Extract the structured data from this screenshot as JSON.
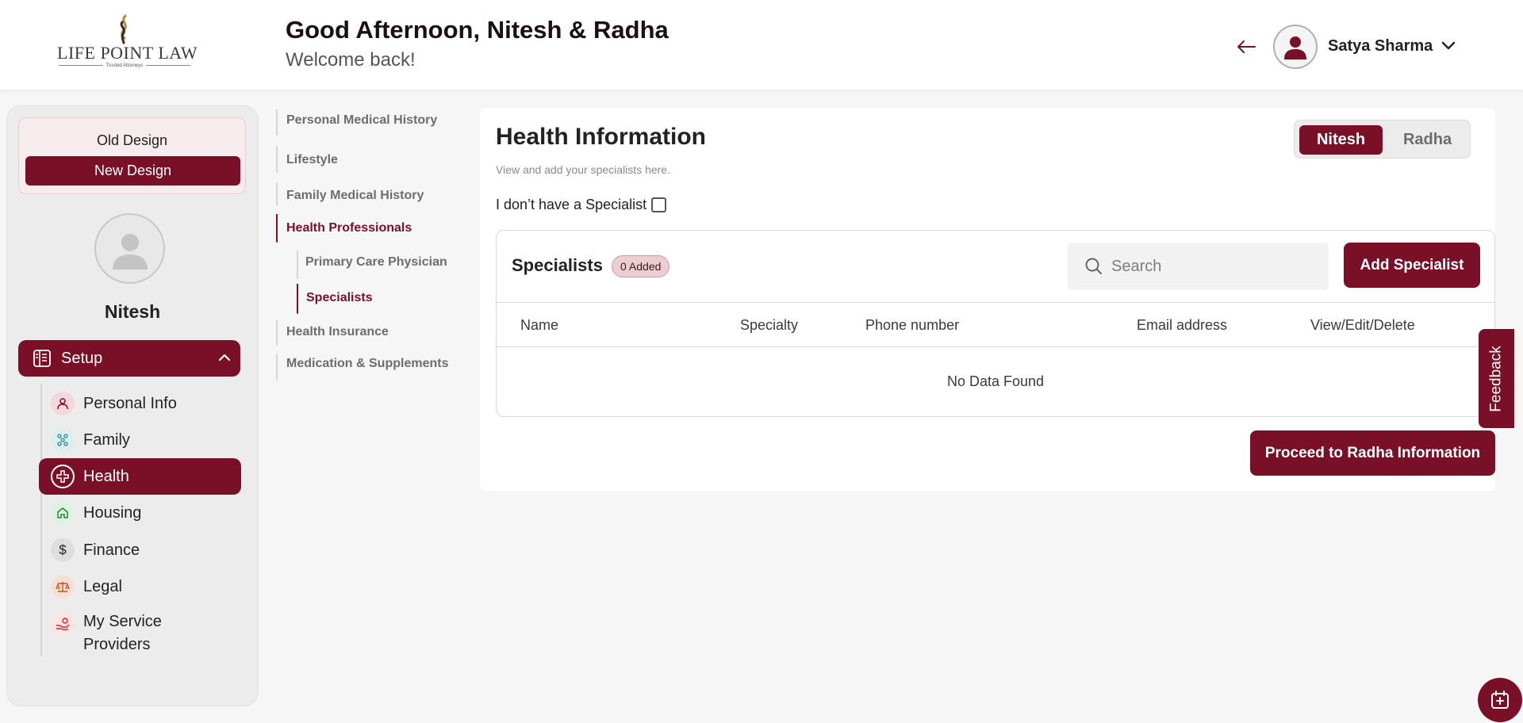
{
  "header": {
    "logo_text": "LIFE POINT LAW",
    "logo_tagline": "Trusted Attorneys",
    "greeting": "Good Afternoon, Nitesh & Radha",
    "welcome": "Welcome back!",
    "user_name": "Satya Sharma"
  },
  "sidebar": {
    "old_design": "Old Design",
    "new_design": "New Design",
    "profile_name": "Nitesh",
    "setup_label": "Setup",
    "items": [
      {
        "label": "Personal Info",
        "icon": "person-icon"
      },
      {
        "label": "Family",
        "icon": "family-icon"
      },
      {
        "label": "Health",
        "icon": "health-icon",
        "active": true
      },
      {
        "label": "Housing",
        "icon": "home-icon"
      },
      {
        "label": "Finance",
        "icon": "dollar-icon"
      },
      {
        "label": "Legal",
        "icon": "scales-icon"
      },
      {
        "label": "My Service Providers",
        "icon": "service-hand-icon"
      }
    ]
  },
  "section_nav": {
    "items": [
      {
        "label": "Personal Medical History"
      },
      {
        "label": "Lifestyle"
      },
      {
        "label": "Family Medical History"
      },
      {
        "label": "Health Professionals",
        "active": true
      },
      {
        "label": "Primary Care Physician",
        "sub": true
      },
      {
        "label": "Specialists",
        "sub": true,
        "active": true
      },
      {
        "label": "Health Insurance"
      },
      {
        "label": "Medication & Supplements"
      }
    ]
  },
  "main": {
    "title": "Health Information",
    "subtitle": "View and add your specialists here.",
    "toggle": {
      "primary": "Nitesh",
      "secondary": "Radha"
    },
    "no_specialist_label": "I don’t have a Specialist",
    "specialists_title": "Specialists",
    "added_badge": "0 Added",
    "search_placeholder": "Search",
    "add_button": "Add Specialist",
    "columns": [
      "Name",
      "Specialty",
      "Phone number",
      "Email address",
      "View/Edit/Delete"
    ],
    "empty_text": "No Data Found",
    "proceed_button": "Proceed to Radha Information"
  },
  "feedback_label": "Feedback",
  "colors": {
    "accent": "#7a1027",
    "background": "#f6f6f6"
  }
}
